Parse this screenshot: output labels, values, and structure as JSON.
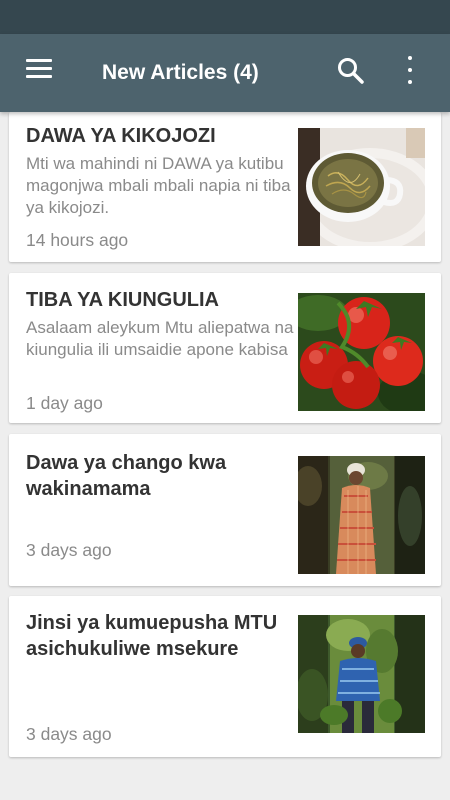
{
  "app_bar": {
    "title": "New Articles (4)",
    "menu_icon": "hamburger-menu-icon",
    "search_icon": "search-icon",
    "overflow_icon": "more-vert-icon",
    "color": "#4d636d",
    "status_bar_color": "#35474f"
  },
  "articles": [
    {
      "title": "DAWA YA KIKOJOZI",
      "summary": "Mti wa mahindi ni DAWA ya kutibu magonjwa mbali mbali napia ni tiba ya kikojozi.",
      "time": "14 hours ago",
      "thumbnail": "herbal-tea-cup-image"
    },
    {
      "title": "TIBA YA KIUNGULIA",
      "summary": "Asalaam aleykum Mtu aliepatwa na kiungulia ili umsaidie apone kabisa",
      "time": "1 day ago",
      "thumbnail": "tomatoes-image"
    },
    {
      "title": "Dawa ya chango kwa wakinamama",
      "summary": "",
      "time": "3 days ago",
      "thumbnail": "woman-in-forest-image"
    },
    {
      "title": "Jinsi ya kumuepusha MTU asichukuliwe msekure",
      "summary": "",
      "time": "3 days ago",
      "thumbnail": "man-in-forest-image"
    }
  ]
}
